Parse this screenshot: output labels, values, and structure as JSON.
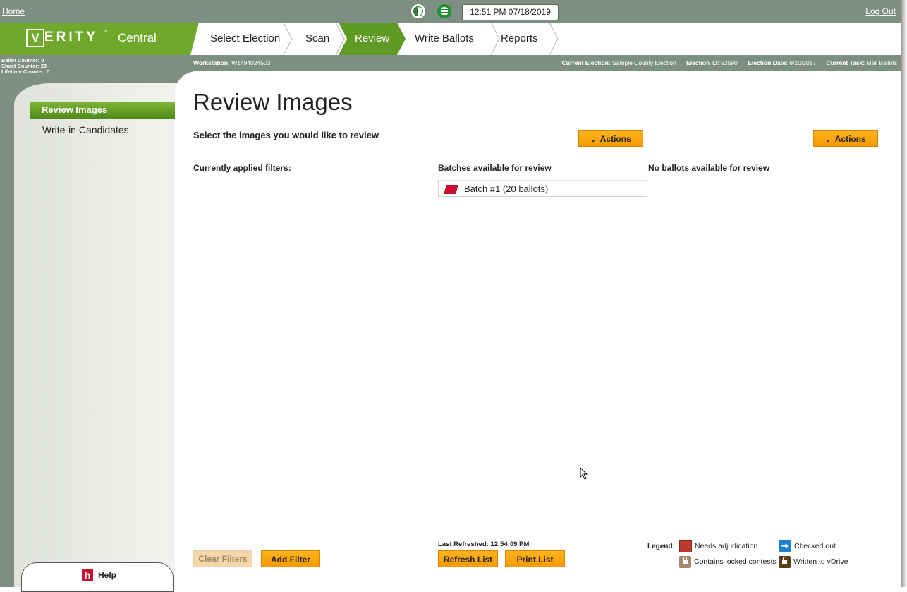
{
  "topbar": {
    "home_label": "Home",
    "clock": "12:51 PM 07/18/2019",
    "logout_label": "Log Out"
  },
  "brand": {
    "logo_letter": "V",
    "name": "ERITY",
    "trademark": "™",
    "subtitle": "Central"
  },
  "nav": {
    "steps": [
      {
        "label": "Select Election",
        "active": false
      },
      {
        "label": "Scan",
        "active": false
      },
      {
        "label": "Review",
        "active": true
      },
      {
        "label": "Write Ballots",
        "active": false
      },
      {
        "label": "Reports",
        "active": false
      }
    ]
  },
  "counters": {
    "ballot": "Ballot Counter: 0",
    "sheet": "Sheet Counter: 20",
    "lifetime": "Lifetime Counter: 0"
  },
  "info": {
    "workstation_label": "Workstation:",
    "workstation": "W1494024503",
    "current_election_label": "Current Election:",
    "current_election": "Sample County Election",
    "election_id_label": "Election ID:",
    "election_id": "92590",
    "election_date_label": "Election Date:",
    "election_date": "6/20/2017",
    "current_task_label": "Current Task:",
    "current_task": "Mail Ballots"
  },
  "sidebar": {
    "items": [
      {
        "label": "Review Images",
        "active": true
      },
      {
        "label": "Write-in Candidates",
        "active": false
      }
    ],
    "help_icon": "h",
    "help_label": "Help"
  },
  "main": {
    "title": "Review Images",
    "subtitle": "Select the images you would like to review",
    "actions_label": "Actions",
    "columns": {
      "filters": "Currently applied filters:",
      "batches": "Batches available for review",
      "ballots": "No ballots available for review"
    },
    "batches": [
      {
        "label": "Batch #1 (20 ballots)"
      }
    ],
    "buttons": {
      "clear_filters": "Clear Filters",
      "add_filter": "Add Filter",
      "refresh_list": "Refresh List",
      "print_list": "Print List"
    },
    "last_refreshed": "Last Refreshed: 12:54:09 PM"
  },
  "legend": {
    "label": "Legend:",
    "needs_adjudication": "Needs adjudication",
    "checked_out": "Checked out",
    "locked_contests": "Contains locked contests",
    "written_vdrive": "Written to vDrive"
  },
  "colors": {
    "brand_green": "#6fa82a",
    "header_gray": "#7d8f83",
    "button_orange": "#f59a00"
  }
}
